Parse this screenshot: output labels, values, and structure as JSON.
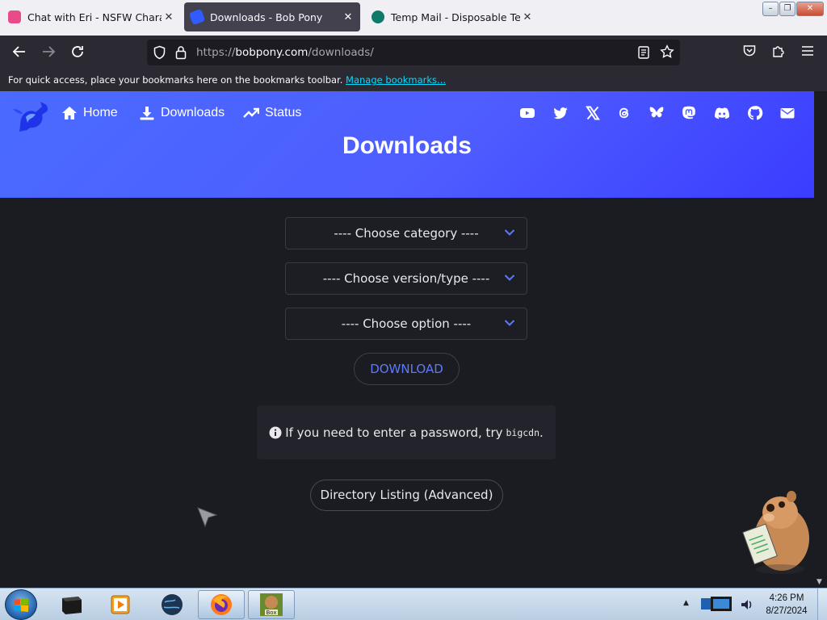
{
  "browser": {
    "tabs": [
      {
        "title": "Chat with Eri - NSFW Character",
        "favicon_color": "#e94a8a",
        "active": false
      },
      {
        "title": "Downloads - Bob Pony",
        "favicon_color": "#2f5bff",
        "active": true
      },
      {
        "title": "Temp Mail - Disposable Tempo",
        "favicon_color": "#0d7a6a",
        "active": false
      }
    ],
    "url_prefix": "https://",
    "url_host": "bobpony.com",
    "url_path": "/downloads/",
    "bookmarks_prompt": "For quick access, place your bookmarks here on the bookmarks toolbar.",
    "bookmarks_link": "Manage bookmarks..."
  },
  "site": {
    "nav": [
      {
        "label": "Home",
        "icon": "home-icon"
      },
      {
        "label": "Downloads",
        "icon": "download-icon"
      },
      {
        "label": "Status",
        "icon": "trend-icon"
      }
    ],
    "social_icons": [
      "youtube-icon",
      "twitter-icon",
      "x-icon",
      "threads-icon",
      "bluesky-icon",
      "mastodon-icon",
      "discord-icon",
      "github-icon",
      "email-icon"
    ],
    "page_title": "Downloads",
    "accent_color": "#4f63ff"
  },
  "form": {
    "category_placeholder": "---- Choose category ----",
    "version_placeholder": "---- Choose version/type ----",
    "option_placeholder": "---- Choose option ----",
    "download_label": "DOWNLOAD",
    "notice_text": "If you need to enter a password, try",
    "notice_code": "bigcdn",
    "notice_end": ".",
    "directory_label": "Directory Listing (Advanced)"
  },
  "taskbar": {
    "time": "4:26 PM",
    "date": "8/27/2024"
  }
}
